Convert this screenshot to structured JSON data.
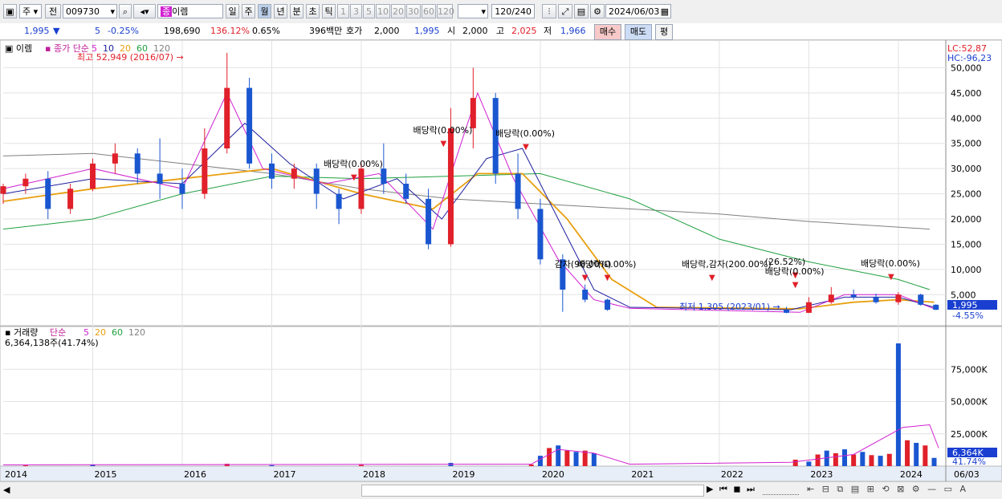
{
  "toolbar": {
    "period_select": "주",
    "prev_label": "전",
    "code": "009730",
    "name_badge": "종",
    "name": "이렘",
    "periods": [
      "일",
      "주",
      "월",
      "년",
      "분",
      "초",
      "틱"
    ],
    "active_period": "월",
    "intervals": [
      "1",
      "3",
      "5",
      "10",
      "20",
      "30",
      "60",
      "120"
    ],
    "count": "120",
    "count_total": "/240",
    "date": "2024/06/03"
  },
  "infobar": {
    "price": "1,995",
    "change": "5",
    "change_pct": "-0.25%",
    "volume": "198,690",
    "vol_ratio": "136.12%",
    "turnover": "0.65%",
    "amount": "396백만",
    "quote_label": "호가",
    "quote": "2,000",
    "quote2": "1,995",
    "open_label": "시",
    "open": "2,000",
    "high_label": "고",
    "high": "2,025",
    "low_label": "저",
    "low": "1,966",
    "buy": "매수",
    "sell": "매도",
    "avg": "평"
  },
  "price_pane": {
    "title": "이렘",
    "legend_label": "종가 단순",
    "ma": [
      "5",
      "10",
      "20",
      "60",
      "120"
    ],
    "lc": "LC:52,87",
    "hc": "HC:-96,23",
    "high_note": "최고 52,949 (2016/07)",
    "low_note": "최저 1,305 (2023/01)",
    "current_price": "1,995",
    "current_pct": "-4.55%",
    "annotations": [
      {
        "text": "배당락(0.00%)",
        "x": 2018.92
      },
      {
        "text": "배당락(0.00%)",
        "x": 2019.84
      },
      {
        "text": "배당락(0.00%)",
        "x": 2017.92
      },
      {
        "text": "감자(90.00%)",
        "x": 2020.5
      },
      {
        "text": "배당락(0.00%)",
        "x": 2020.75
      },
      {
        "text": "배당락,감자(200.00%)",
        "x": 2021.92
      },
      {
        "text": "(26.52%)",
        "x": 2022.85
      },
      {
        "text": "배당락(0.00%)",
        "x": 2022.85
      },
      {
        "text": "배당락(0.00%)",
        "x": 2023.92
      }
    ],
    "colors": {
      "up": "#e0202a",
      "down": "#1a56d0",
      "ma5": "#d020d0",
      "ma10": "#2020a0",
      "ma20": "#e8a010",
      "ma60": "#20a040",
      "ma120": "#808080"
    }
  },
  "volume_pane": {
    "title": "거래량",
    "legend_label": "단순",
    "ma": [
      "5",
      "20",
      "60",
      "120"
    ],
    "summary": "6,364,138주(41.74%)",
    "current": "6,364K",
    "current_pct": "41.74%"
  },
  "x_axis": {
    "labels": [
      "2014",
      "2015",
      "2016",
      "2017",
      "2018",
      "2019",
      "2020",
      "2021",
      "2022",
      "2023",
      "2024",
      "06/03"
    ]
  },
  "chart_data": {
    "type": "candlestick",
    "price_axis": {
      "ticks": [
        50000,
        45000,
        40000,
        35000,
        30000,
        25000,
        20000,
        15000,
        10000,
        5000
      ]
    },
    "volume_axis": {
      "ticks": [
        "75,000K",
        "50,000K",
        "25,000K"
      ]
    },
    "candles": [
      [
        2014.0,
        25000,
        26500,
        23000,
        27000
      ],
      [
        2014.25,
        26500,
        28000,
        25000,
        29000
      ],
      [
        2014.5,
        28000,
        22000,
        20000,
        29500
      ],
      [
        2014.75,
        22000,
        26000,
        21000,
        27000
      ],
      [
        2015.0,
        26000,
        31000,
        25500,
        32000
      ],
      [
        2015.25,
        31000,
        33000,
        29000,
        35000
      ],
      [
        2015.5,
        33000,
        29000,
        27000,
        34000
      ],
      [
        2015.75,
        29000,
        27000,
        24000,
        36000
      ],
      [
        2016.0,
        27000,
        25000,
        22000,
        30000
      ],
      [
        2016.25,
        25000,
        34000,
        24000,
        38000
      ],
      [
        2016.5,
        34000,
        46000,
        33000,
        52949
      ],
      [
        2016.75,
        46000,
        31000,
        30000,
        48000
      ],
      [
        2017.0,
        31000,
        28000,
        26000,
        33000
      ],
      [
        2017.25,
        28000,
        30000,
        26000,
        31000
      ],
      [
        2017.5,
        30000,
        25000,
        22000,
        31000
      ],
      [
        2017.75,
        25000,
        22000,
        19000,
        26000
      ],
      [
        2018.0,
        22000,
        30000,
        21000,
        31000
      ],
      [
        2018.25,
        30000,
        27000,
        25000,
        35000
      ],
      [
        2018.5,
        27000,
        24000,
        23000,
        29000
      ],
      [
        2018.75,
        24000,
        15000,
        14000,
        26000
      ],
      [
        2019.0,
        15000,
        38000,
        14500,
        42000
      ],
      [
        2019.25,
        38000,
        44000,
        34000,
        50000
      ],
      [
        2019.5,
        44000,
        29000,
        27000,
        45000
      ],
      [
        2019.75,
        29000,
        22000,
        20000,
        33000
      ],
      [
        2020.0,
        22000,
        12000,
        11000,
        24000
      ],
      [
        2020.25,
        12000,
        6000,
        1600,
        13000
      ],
      [
        2020.5,
        6000,
        4000,
        3500,
        7000
      ],
      [
        2020.75,
        4000,
        2000,
        1800,
        4200
      ],
      [
        2022.75,
        2000,
        1400,
        1305,
        2600
      ],
      [
        2023.0,
        1400,
        3500,
        1350,
        4500
      ],
      [
        2023.25,
        3500,
        5000,
        3200,
        6500
      ],
      [
        2023.5,
        5000,
        4500,
        4000,
        6000
      ],
      [
        2023.75,
        4500,
        3500,
        3200,
        5200
      ],
      [
        2024.0,
        3500,
        5000,
        3000,
        5500
      ],
      [
        2024.25,
        5000,
        3000,
        2800,
        5200
      ],
      [
        2024.42,
        3000,
        1995,
        1966,
        3100
      ]
    ],
    "volume_bars": [
      [
        2014.25,
        600
      ],
      [
        2015.0,
        900
      ],
      [
        2016.5,
        1800
      ],
      [
        2017.0,
        700
      ],
      [
        2018.0,
        900
      ],
      [
        2019.0,
        2500
      ],
      [
        2019.9,
        1200
      ],
      [
        2020.0,
        8000
      ],
      [
        2020.1,
        14000
      ],
      [
        2020.2,
        16000
      ],
      [
        2020.3,
        12000
      ],
      [
        2020.4,
        11000
      ],
      [
        2020.5,
        12000
      ],
      [
        2020.6,
        10000
      ],
      [
        2022.85,
        5000
      ],
      [
        2023.0,
        3500
      ],
      [
        2023.1,
        9000
      ],
      [
        2023.2,
        12000
      ],
      [
        2023.3,
        10000
      ],
      [
        2023.4,
        13000
      ],
      [
        2023.5,
        9000
      ],
      [
        2023.6,
        11000
      ],
      [
        2023.7,
        8500
      ],
      [
        2023.8,
        8000
      ],
      [
        2023.9,
        9500
      ],
      [
        2024.0,
        95000
      ],
      [
        2024.1,
        20000
      ],
      [
        2024.2,
        18000
      ],
      [
        2024.3,
        16000
      ],
      [
        2024.4,
        6364
      ]
    ]
  }
}
